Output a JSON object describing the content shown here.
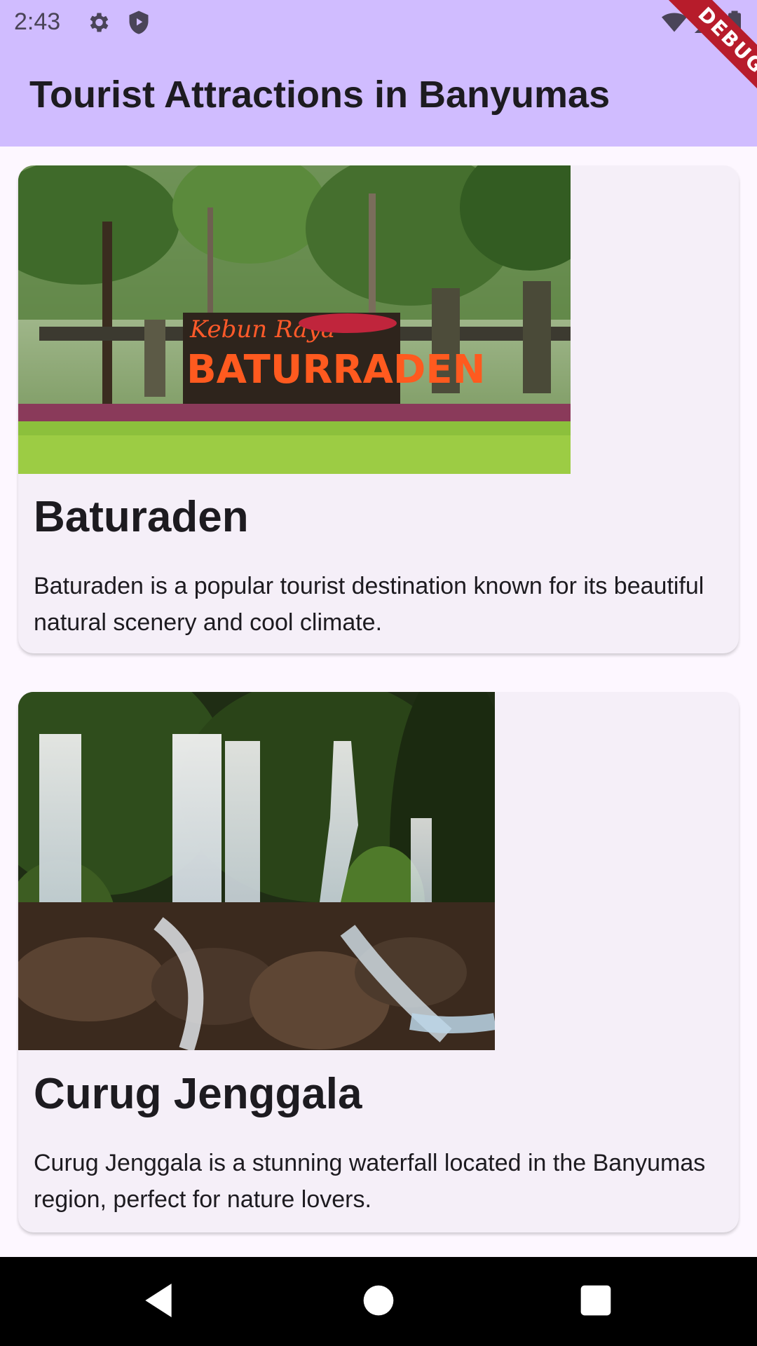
{
  "status_bar": {
    "time": "2:43",
    "icons": [
      "settings-gear-icon",
      "shield-play-icon",
      "wifi-icon",
      "signal-icon",
      "battery-icon"
    ]
  },
  "debug_banner": "DEBUG",
  "app_bar": {
    "title": "Tourist Attractions in Banyumas",
    "background": "#d0bcff"
  },
  "attractions": [
    {
      "title": "Baturaden",
      "description": "Baturaden is a popular tourist destination known for its beautiful natural scenery and cool climate.",
      "image": {
        "alt": "Kebun Raya BATURRADEN sign in a garden",
        "sign_line1": "Kebun Raya",
        "sign_line2": "BATURRADEN"
      }
    },
    {
      "title": "Curug Jenggala",
      "description": "Curug Jenggala is a stunning waterfall located in the Banyumas region, perfect for nature lovers.",
      "image": {
        "alt": "Waterfalls cascading over rocks in a forest"
      }
    }
  ],
  "nav_bar": {
    "buttons": [
      "back-icon",
      "home-icon",
      "recents-icon"
    ]
  },
  "colors": {
    "background": "#fdf7ff",
    "card": "#f5eff8",
    "text": "#1d1b20",
    "accent": "#d0bcff"
  }
}
